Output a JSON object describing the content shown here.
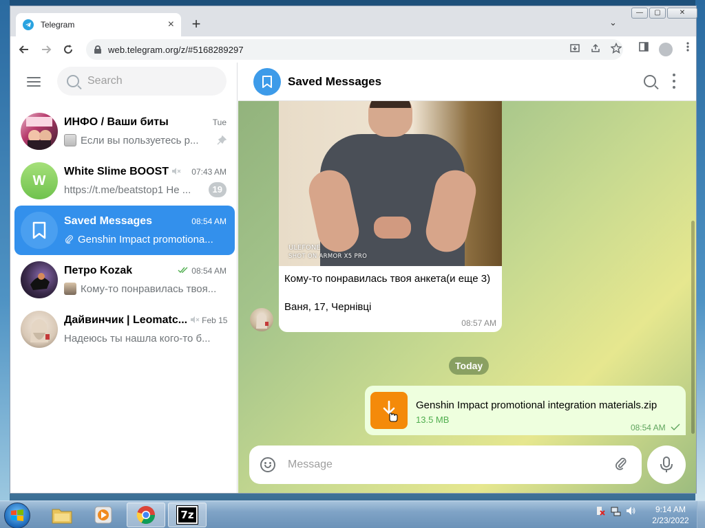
{
  "browser": {
    "tab_title": "Telegram",
    "tab_close": "×",
    "new_tab": "+",
    "tab_menu": "⌄",
    "url": "web.telegram.org/z/#5168289297",
    "window_buttons": {
      "minimize": "—",
      "maximize": "▢",
      "close": "✕"
    }
  },
  "search": {
    "placeholder": "Search"
  },
  "chats": [
    {
      "name": "ИНФО / Ваши биты",
      "time": "Tue",
      "preview": "Если вы пользуетесь р...",
      "pinned": true,
      "avatar_color": "#b73a6c"
    },
    {
      "name": "White Slime BOOST",
      "time": "07:43 AM",
      "preview": "https://t.me/beatstop1 Не ...",
      "muted": true,
      "unread": "19",
      "avatar_letter": "W",
      "avatar_color": "#8fd26a"
    },
    {
      "name": "Saved Messages",
      "time": "08:54 AM",
      "preview": "Genshin Impact promotiona...",
      "active": true,
      "avatar_color": "#4a9ff0"
    },
    {
      "name": "Петро Kozak",
      "time": "08:54 AM",
      "preview": "Кому-то понравилась твоя...",
      "read": true,
      "avatar_color": "#3a2a4a"
    },
    {
      "name": "Дайвинчик | Leomatc...",
      "time": "Feb 15",
      "preview": "Надеюсь ты нашла кого-то б...",
      "muted": true,
      "avatar_color": "#d8c8b6"
    }
  ],
  "chat_header": {
    "title": "Saved Messages"
  },
  "messages": {
    "photo": {
      "watermark_line1": "ULEFONE",
      "watermark_line2": "SHOT ON ARMOR X5 PRO",
      "caption_line1": "Кому-то понравилась твоя анкета(и еще 3)",
      "caption_line2": "Ваня, 17, Чернівці",
      "time": "08:57 AM"
    },
    "date_separator": "Today",
    "file": {
      "name": "Genshin Impact promotional integration materials.zip",
      "size": "13.5 MB",
      "time": "08:54 AM"
    }
  },
  "composer": {
    "placeholder": "Message"
  },
  "taskbar": {
    "time": "9:14 AM",
    "date": "2/23/2022",
    "archive_label": "7z"
  },
  "colors": {
    "accent": "#3390ec",
    "file_icon": "#f48a0a",
    "outgoing_bubble": "#eeffde",
    "read_check": "#4fae4e"
  },
  "icons": {
    "tab": "telegram-icon",
    "back": "arrow-left-icon",
    "forward": "arrow-right-icon",
    "reload": "reload-icon",
    "lock": "lock-icon",
    "install": "install-icon",
    "share": "share-icon",
    "bookmark": "star-icon",
    "side_panel": "side-panel-icon",
    "profile": "profile-icon",
    "menu": "more-vert-icon",
    "hamburger": "hamburger-icon",
    "search": "search-icon",
    "emoji": "smile-icon",
    "attach": "paperclip-icon",
    "mic": "mic-icon",
    "download": "download-icon"
  }
}
